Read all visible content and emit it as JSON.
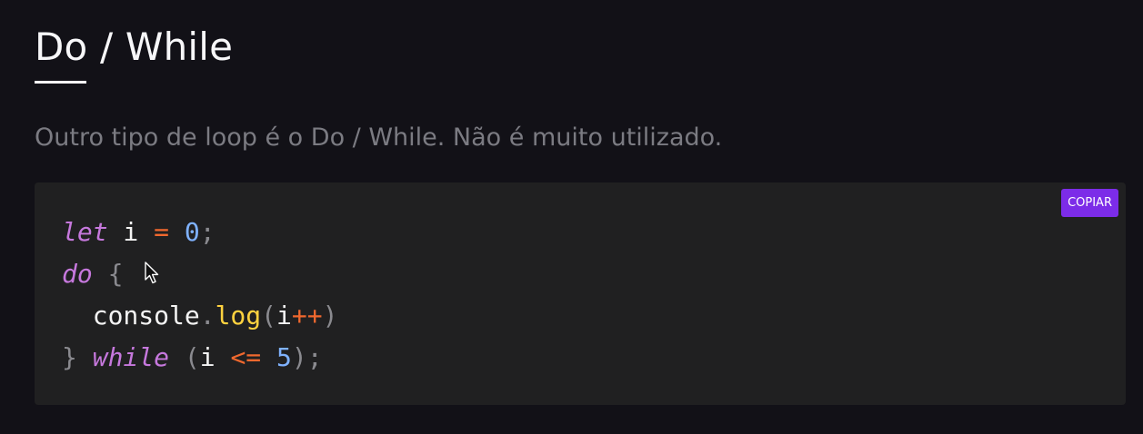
{
  "section": {
    "title": "Do / While",
    "description": "Outro tipo de loop é o Do / While. Não é muito utilizado."
  },
  "code_block": {
    "copy_label": "COPIAR",
    "lines": [
      [
        {
          "t": "let",
          "k": "kw"
        },
        {
          "t": " i ",
          "k": "ident"
        },
        {
          "t": "=",
          "k": "op"
        },
        {
          "t": " ",
          "k": "ident"
        },
        {
          "t": "0",
          "k": "num"
        },
        {
          "t": ";",
          "k": "punc"
        }
      ],
      [
        {
          "t": "do",
          "k": "kw"
        },
        {
          "t": " ",
          "k": "ident"
        },
        {
          "t": "{",
          "k": "punc"
        }
      ],
      [
        {
          "t": "  console",
          "k": "ident"
        },
        {
          "t": ".",
          "k": "punc"
        },
        {
          "t": "log",
          "k": "fn"
        },
        {
          "t": "(",
          "k": "punc"
        },
        {
          "t": "i",
          "k": "ident"
        },
        {
          "t": "++",
          "k": "op"
        },
        {
          "t": ")",
          "k": "punc"
        }
      ],
      [
        {
          "t": "}",
          "k": "punc"
        },
        {
          "t": " ",
          "k": "ident"
        },
        {
          "t": "while",
          "k": "kw"
        },
        {
          "t": " ",
          "k": "ident"
        },
        {
          "t": "(",
          "k": "punc"
        },
        {
          "t": "i ",
          "k": "ident"
        },
        {
          "t": "<=",
          "k": "op"
        },
        {
          "t": " ",
          "k": "ident"
        },
        {
          "t": "5",
          "k": "num"
        },
        {
          "t": ")",
          "k": "punc"
        },
        {
          "t": ";",
          "k": "punc"
        }
      ]
    ]
  },
  "icons": {
    "cursor": "mouse-pointer-icon"
  },
  "colors": {
    "background": "#121117",
    "code_background": "#202021",
    "accent": "#7c2ce8",
    "keyword": "#c678dd",
    "operator": "#f0682e",
    "number": "#7fb2ff",
    "function": "#ffd23f"
  }
}
